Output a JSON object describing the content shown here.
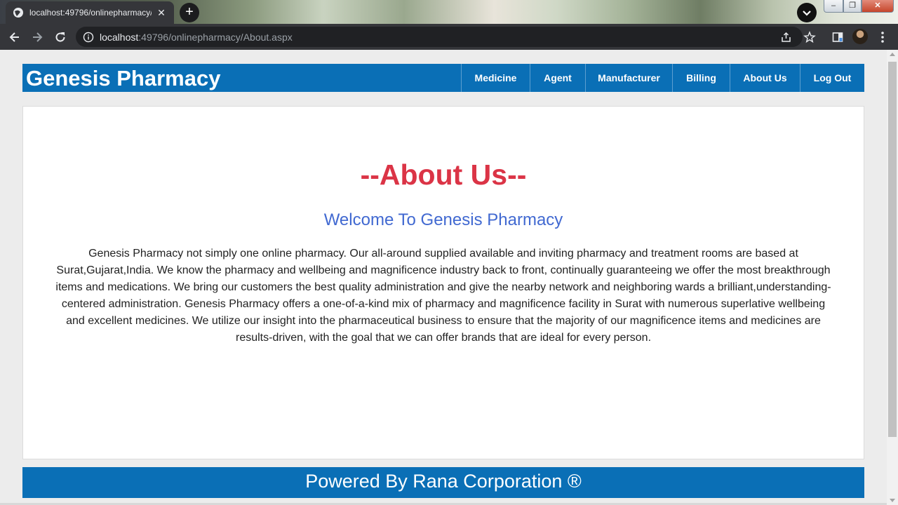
{
  "browser": {
    "tab_title": "localhost:49796/onlinepharmacy/",
    "tab_close": "✕",
    "newtab_label": "+",
    "url_host": "localhost",
    "url_rest": ":49796/onlinepharmacy/About.aspx",
    "win_min": "–",
    "win_max": "❐",
    "win_close": "✕"
  },
  "header": {
    "brand": "Genesis Pharmacy",
    "menu": [
      {
        "label": "Medicine"
      },
      {
        "label": "Agent"
      },
      {
        "label": "Manufacturer"
      },
      {
        "label": "Billing"
      },
      {
        "label": "About Us"
      },
      {
        "label": "Log Out"
      }
    ]
  },
  "main": {
    "heading": "--About Us--",
    "welcome": "Welcome To Genesis Pharmacy",
    "paragraph": "Genesis Pharmacy not simply one online pharmacy. Our all-around supplied available and inviting pharmacy and treatment rooms are based at Surat,Gujarat,India. We know the pharmacy and wellbeing and magnificence industry back to front, continually guaranteeing we offer the most breakthrough items and medications. We bring our customers the best quality administration and give the nearby network and neighboring wards a brilliant,understanding-centered administration. Genesis Pharmacy offers a one-of-a-kind mix of pharmacy and magnificence facility in Surat with numerous superlative wellbeing and excellent medicines. We utilize our insight into the pharmaceutical business to ensure that the majority of our magnificence items and medicines are results-driven, with the goal that we can offer brands that are ideal for every person."
  },
  "footer": {
    "text": "Powered By Rana Corporation ®"
  },
  "colors": {
    "brand_blue": "#0a6fb6",
    "heading_red": "#db3446",
    "welcome_blue": "#4169d1"
  },
  "icons": [
    "globe-icon",
    "close-icon",
    "plus-icon",
    "chevron-down-icon",
    "back-icon",
    "forward-icon",
    "reload-icon",
    "info-icon",
    "share-icon",
    "star-icon",
    "sidepanel-icon",
    "kebab-menu-icon"
  ]
}
